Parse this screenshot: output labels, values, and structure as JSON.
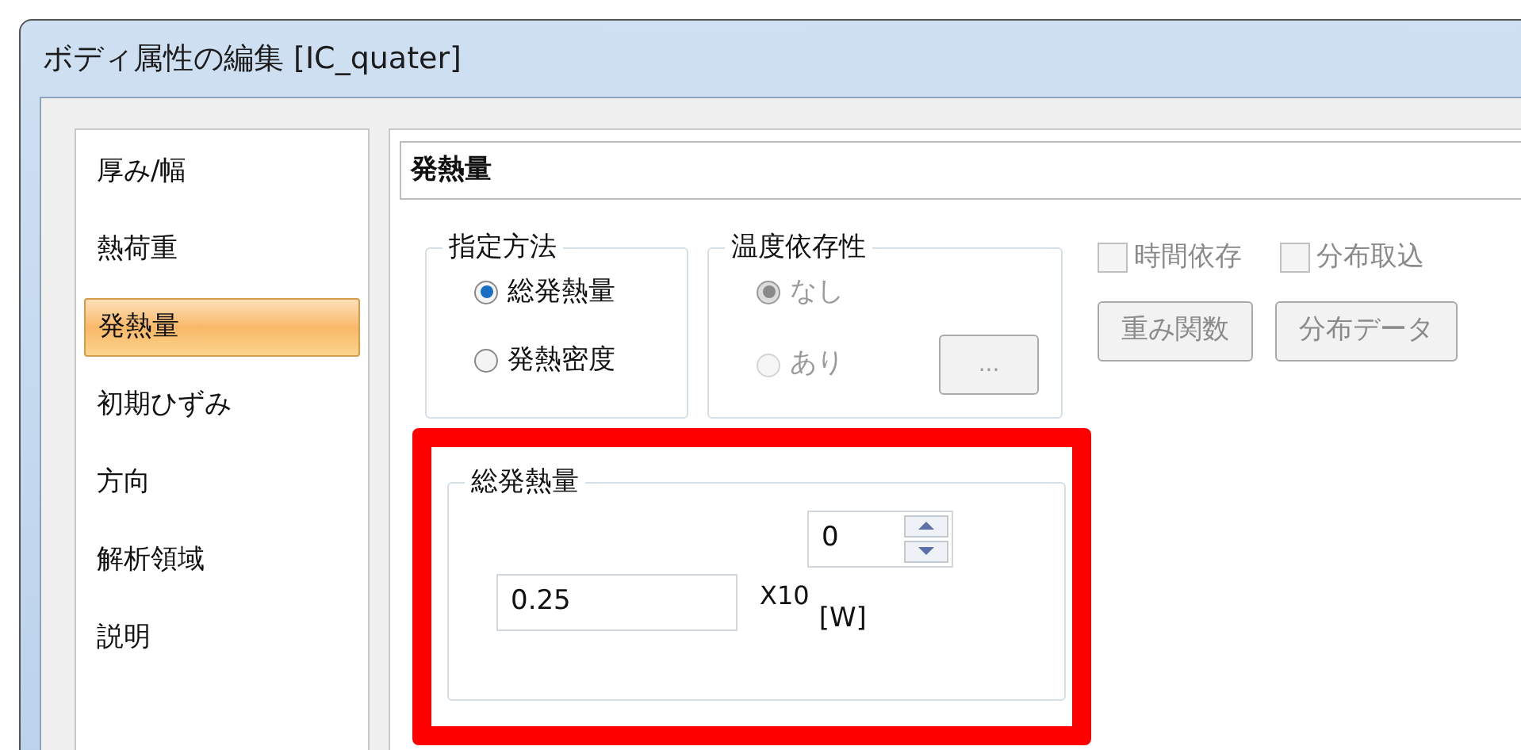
{
  "window": {
    "title": "ボディ属性の編集 [IC_quater]"
  },
  "sidebar": {
    "items": [
      {
        "label": "厚み/幅",
        "selected": false
      },
      {
        "label": "熱荷重",
        "selected": false
      },
      {
        "label": "発熱量",
        "selected": true
      },
      {
        "label": "初期ひずみ",
        "selected": false
      },
      {
        "label": "方向",
        "selected": false
      },
      {
        "label": "解析領域",
        "selected": false
      },
      {
        "label": "説明",
        "selected": false
      }
    ]
  },
  "panel": {
    "title": "発熱量",
    "method_group": {
      "title": "指定方法",
      "options": [
        {
          "label": "総発熱量",
          "selected": true
        },
        {
          "label": "発熱密度",
          "selected": false
        }
      ]
    },
    "temperature_group": {
      "title": "温度依存性",
      "disabled": true,
      "options": [
        {
          "label": "なし",
          "selected": true
        },
        {
          "label": "あり",
          "selected": false
        }
      ],
      "button": "..."
    },
    "checkboxes": [
      {
        "label": "時間依存",
        "checked": false,
        "disabled": true
      },
      {
        "label": "分布取込",
        "checked": false,
        "disabled": true
      }
    ],
    "buttons": [
      {
        "label": "重み関数",
        "disabled": true
      },
      {
        "label": "分布データ",
        "disabled": true
      }
    ],
    "total_group": {
      "title": "総発熱量",
      "value": "0.25",
      "multiplier": "X10",
      "exponent": "0",
      "unit": "[W]",
      "highlighted": true
    }
  }
}
